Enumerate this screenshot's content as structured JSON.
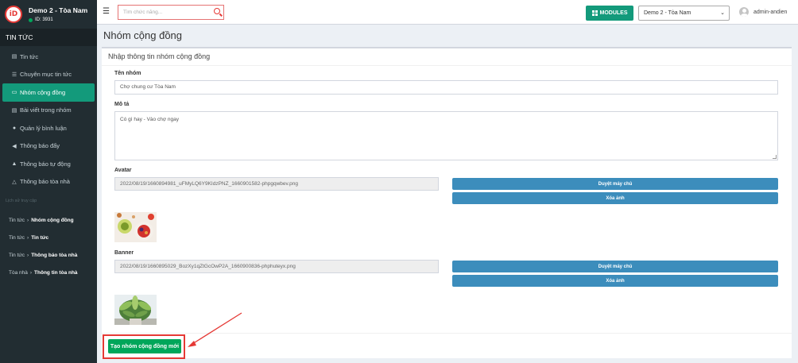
{
  "sidebar": {
    "brand_name": "Demo 2 - Tòa Nam",
    "brand_id": "ID: 3931",
    "section": "TIN TỨC",
    "items": [
      {
        "label": "Tin tức",
        "icon": "newspaper-icon"
      },
      {
        "label": "Chuyên mục tin tức",
        "icon": "list-icon"
      },
      {
        "label": "Nhóm cộng đồng",
        "icon": "comments-icon"
      },
      {
        "label": "Bài viết trong nhóm",
        "icon": "article-icon"
      },
      {
        "label": "Quản lý bình luận",
        "icon": "chat-icon"
      },
      {
        "label": "Thông báo đẩy",
        "icon": "megaphone-icon"
      },
      {
        "label": "Thông báo tự động",
        "icon": "bell-icon"
      },
      {
        "label": "Thông báo tòa nhà",
        "icon": "bell-outline-icon"
      }
    ],
    "history_title": "Lịch sử truy cập",
    "history": [
      {
        "parent": "Tin tức",
        "child": "Nhóm cộng đồng"
      },
      {
        "parent": "Tin tức",
        "child": "Tin tức"
      },
      {
        "parent": "Tin tức",
        "child": "Thông báo tòa nhà"
      },
      {
        "parent": "Tòa nhà",
        "child": "Thông tin tòa nhà"
      }
    ]
  },
  "topbar": {
    "search_placeholder": "Tìm chức năng...",
    "modules_label": "MODULES",
    "building_selected": "Demo 2 - Tòa Nam",
    "username": "admin-andien"
  },
  "page": {
    "title": "Nhóm cộng đồng",
    "card_title": "Nhập thông tin nhóm cộng đồng",
    "name_label": "Tên nhóm",
    "name_value": "Chợ chung cư Tòa Nam",
    "desc_label": "Mô tả",
    "desc_value": "Có gì hay - Vào chợ ngay",
    "avatar_label": "Avatar",
    "avatar_path": "2022/08/19/1660894981_uFMyLQ6Y9KIdzPNZ_1660901582-phpgqwbev.png",
    "banner_label": "Banner",
    "banner_path": "2022/08/19/1660895029_BozXy1qZtGcOwP2A_1660900836-phphuteyx.png",
    "browse_label": "Duyệt máy chủ",
    "delete_label": "Xóa ảnh",
    "create_label": "Tạo nhóm cộng đồng mới"
  },
  "colors": {
    "sidebar_bg": "#222d32",
    "active_teal": "#139a7b",
    "blue_button": "#3c8dbc",
    "green_button": "#00a65a",
    "annotation_red": "#e53935"
  }
}
